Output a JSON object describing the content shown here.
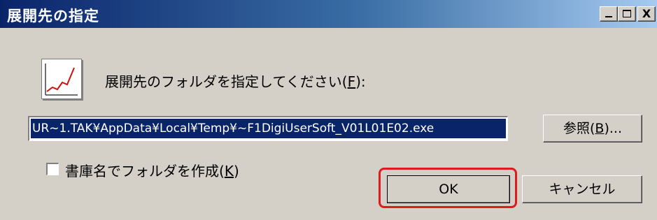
{
  "window": {
    "title": "展開先の指定",
    "controls": [
      "minimize",
      "maximize",
      "close"
    ],
    "close_glyph": "X"
  },
  "prompt": {
    "text": "展開先のフォルダを指定してください(",
    "mnemonic": "F",
    "suffix": "):"
  },
  "path_field": {
    "value": "UR~1.TAK¥AppData¥Local¥Temp¥~F1DigiUserSoft_V01L01E02.exe"
  },
  "buttons": {
    "browse": {
      "prefix": "参照(",
      "mnemonic": "B",
      "suffix": ")..."
    },
    "ok": "OK",
    "cancel": "キャンセル"
  },
  "checkbox": {
    "label_prefix": "書庫名でフォルダを作成(",
    "mnemonic": "K",
    "label_suffix": ")",
    "checked": false
  },
  "icons": {
    "app": "line-chart-icon"
  },
  "colors": {
    "titlebar_start": "#0a246a",
    "titlebar_end": "#a6caf0",
    "highlight": "#e11b1b",
    "selection": "#0a246a"
  }
}
